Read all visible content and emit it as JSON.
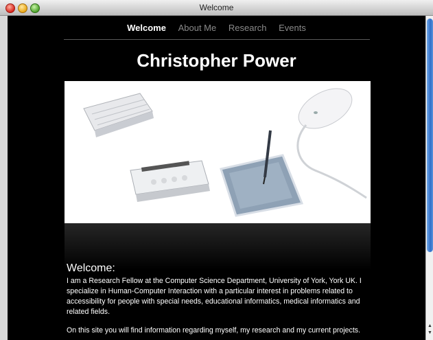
{
  "window": {
    "title": "Welcome"
  },
  "nav": {
    "items": [
      "Welcome",
      "About Me",
      "Research",
      "Events"
    ],
    "active": "Welcome"
  },
  "page": {
    "title": "Christopher Power"
  },
  "content": {
    "heading": "Welcome:",
    "paragraph1": "I am a Research Fellow at the Computer Science Department, University of York, York UK. I specialize in Human-Computer Interaction with a particular interest in problems related to accessibility for people with special needs, educational informatics, medical informatics and related fields.",
    "paragraph2": "On this site you will find information regarding myself, my research and my current projects."
  },
  "icons": [
    "close-icon",
    "minimize-icon",
    "zoom-icon",
    "keyboard-icon",
    "mouse-icon",
    "braille-device-icon",
    "graphics-tablet-icon",
    "scroll-up-arrow-icon",
    "scroll-down-arrow-icon"
  ],
  "colors": {
    "background": "#000000",
    "text": "#ffffff",
    "nav_inactive": "#8a8a8a",
    "scroll_thumb": "#2f6fc8"
  }
}
